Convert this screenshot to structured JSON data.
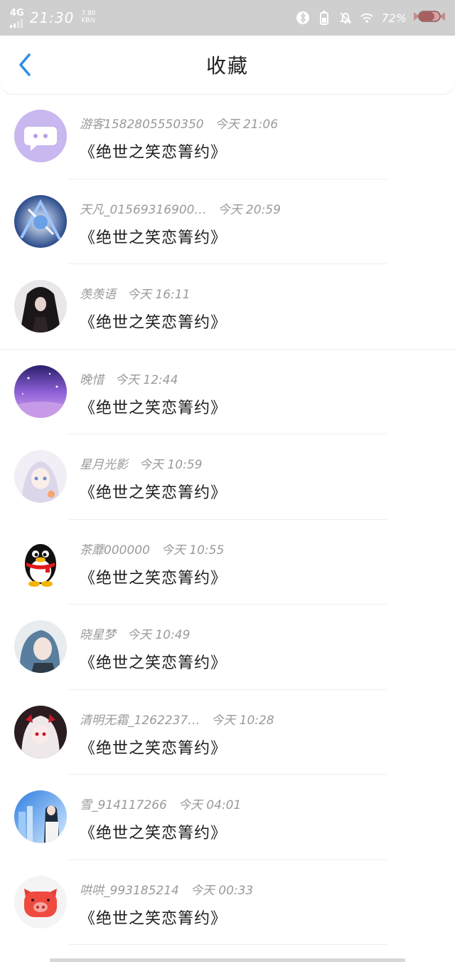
{
  "status_bar": {
    "network": "4G",
    "time": "21:30",
    "speed_value": "7.80",
    "speed_unit": "KB/s",
    "battery": "72%",
    "icons": [
      "bluetooth-icon",
      "battery-small-icon",
      "bell-off-icon",
      "wifi-icon",
      "candy-battery-icon"
    ]
  },
  "header": {
    "back_icon": "chevron-left-icon",
    "title": "收藏"
  },
  "items": [
    {
      "name": "游客1582805550350",
      "time": "今天 21:06",
      "text": "《绝世之笑恋箐约》",
      "avatar": "chat-bubble"
    },
    {
      "name": "天凡_01569316900…",
      "time": "今天 20:59",
      "text": "《绝世之笑恋箐约》",
      "avatar": "anime-blue"
    },
    {
      "name": "羡羡语",
      "time": "今天 16:11",
      "text": "《绝世之笑恋箐约》",
      "avatar": "anime-dark"
    },
    {
      "name": "晚惜",
      "time": "今天 12:44",
      "text": "《绝世之笑恋箐约》",
      "avatar": "purple-sky"
    },
    {
      "name": "星月光影",
      "time": "今天 10:59",
      "text": "《绝世之笑恋箐约》",
      "avatar": "anime-light"
    },
    {
      "name": "茶蘼000000",
      "time": "今天 10:55",
      "text": "《绝世之笑恋箐约》",
      "avatar": "penguin"
    },
    {
      "name": "晓星梦",
      "time": "今天 10:49",
      "text": "《绝世之笑恋箐约》",
      "avatar": "anime-teal"
    },
    {
      "name": "清明无霜_1262237…",
      "time": "今天 10:28",
      "text": "《绝世之笑恋箐约》",
      "avatar": "anime-red"
    },
    {
      "name": "雪_914117266",
      "time": "今天 04:01",
      "text": "《绝世之笑恋箐约》",
      "avatar": "anime-city"
    },
    {
      "name": "哄哄_993185214",
      "time": "今天 00:33",
      "text": "《绝世之笑恋箐约》",
      "avatar": "pig"
    }
  ],
  "colors": {
    "accent": "#2f8ee8",
    "status_bar": "#cfcfcf",
    "meta_text": "#9a9a9a"
  }
}
